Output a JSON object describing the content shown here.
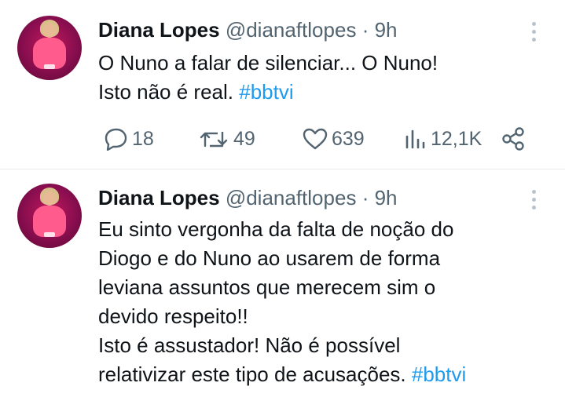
{
  "tweets": [
    {
      "name": "Diana Lopes",
      "handle": "@dianaftlopes",
      "separator": "·",
      "time": "9h",
      "lines": [
        "O Nuno a falar de silenciar... O Nuno!",
        "Isto não é real. "
      ],
      "hashtag": "#bbtvi",
      "replies": "18",
      "retweets": "49",
      "likes": "639",
      "views": "12,1K"
    },
    {
      "name": "Diana Lopes",
      "handle": "@dianaftlopes",
      "separator": "·",
      "time": "9h",
      "lines": [
        "Eu sinto vergonha da falta de noção do",
        "Diogo e do Nuno ao usarem de forma",
        "leviana assuntos que merecem sim o",
        "devido respeito!!",
        "Isto é assustador! Não é possível",
        "relativizar este tipo de acusações. "
      ],
      "hashtag": "#bbtvi"
    }
  ],
  "icons": {
    "reply": "reply-icon",
    "retweet": "retweet-icon",
    "like": "heart-icon",
    "views": "views-chart-icon",
    "share": "share-icon",
    "more": "more-vertical-icon"
  },
  "colors": {
    "text": "#0f1419",
    "secondary": "#536471",
    "hashtag": "#1d9bf0",
    "divider": "#e7e9ec",
    "avatar_bg": "#c2185b"
  }
}
